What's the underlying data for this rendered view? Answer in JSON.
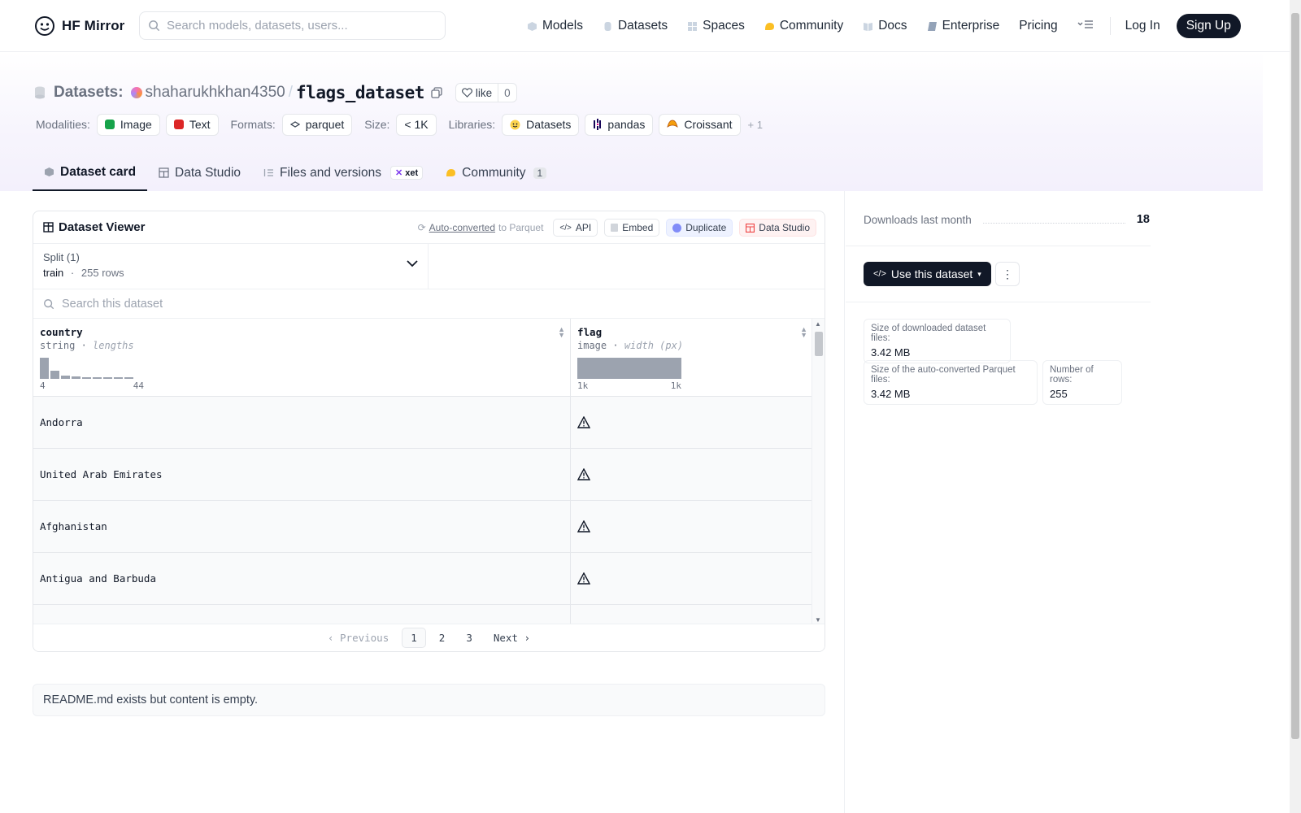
{
  "nav": {
    "brand": "HF Mirror",
    "search_placeholder": "Search models, datasets, users...",
    "links": [
      "Models",
      "Datasets",
      "Spaces",
      "Community",
      "Docs",
      "Enterprise",
      "Pricing"
    ],
    "login": "Log In",
    "signup": "Sign Up"
  },
  "header": {
    "kind": "Datasets:",
    "owner": "shaharukhkhan4350",
    "separator": "/",
    "name": "flags_dataset",
    "like_label": "like",
    "like_count": "0"
  },
  "meta": {
    "modalities_label": "Modalities:",
    "modalities": [
      "Image",
      "Text"
    ],
    "formats_label": "Formats:",
    "format": "parquet",
    "size_label": "Size:",
    "size": "< 1K",
    "libraries_label": "Libraries:",
    "libraries": [
      "Datasets",
      "pandas",
      "Croissant"
    ],
    "more": "+ 1"
  },
  "tabs": {
    "dataset_card": "Dataset card",
    "data_studio": "Data Studio",
    "files": "Files and versions",
    "xet": "xet",
    "community": "Community",
    "community_count": "1"
  },
  "viewer": {
    "title": "Dataset Viewer",
    "auto_converted": "Auto-converted",
    "to_parquet": "to Parquet",
    "api": "API",
    "embed": "Embed",
    "duplicate": "Duplicate",
    "data_studio": "Data Studio",
    "split_label": "Split (1)",
    "split_name": "train",
    "split_dot": "·",
    "split_rows": "255 rows",
    "search_placeholder": "Search this dataset",
    "columns": [
      {
        "name": "country",
        "type": "string",
        "stat": "lengths",
        "min": "4",
        "max": "44"
      },
      {
        "name": "flag",
        "type": "image",
        "stat": "width (px)",
        "min": "1k",
        "max": "1k"
      }
    ],
    "country_length_histogram": [
      1.0,
      0.4,
      0.14,
      0.1,
      0.08,
      0.06,
      0.05,
      0.04,
      0.04
    ],
    "rows": [
      "Andorra",
      "United Arab Emirates",
      "Afghanistan",
      "Antigua and Barbuda"
    ],
    "pager": {
      "prev": "Previous",
      "pages": [
        "1",
        "2",
        "3"
      ],
      "current": "1",
      "next": "Next"
    }
  },
  "readme": "README.md exists but content is empty.",
  "sidebar": {
    "downloads_label": "Downloads last month",
    "downloads": "18",
    "use_button": "Use this dataset",
    "stats": {
      "downloaded_label": "Size of downloaded dataset files:",
      "downloaded_value": "3.42 MB",
      "parquet_label": "Size of the auto-converted Parquet files:",
      "parquet_value": "3.42 MB",
      "rows_label": "Number of rows:",
      "rows_value": "255"
    }
  },
  "colors": {
    "accent_dark": "#111827",
    "header_tint": "#f3f0fc",
    "image_badge": "#16a34a",
    "text_badge": "#dc2626"
  }
}
